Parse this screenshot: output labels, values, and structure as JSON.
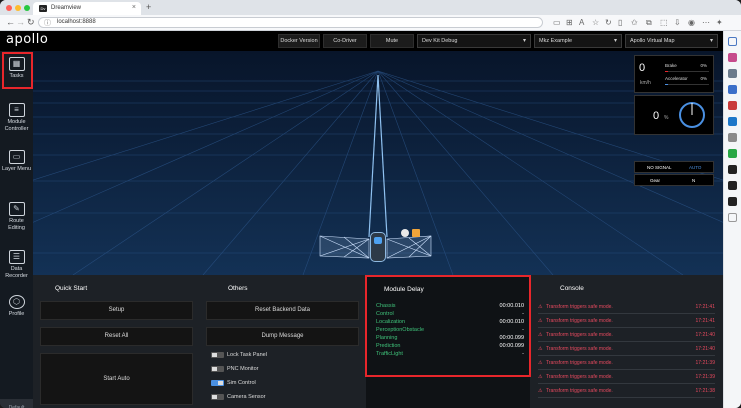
{
  "browser": {
    "tab_title": "Dreamview",
    "tab_favicon": "Dv",
    "url": "localhost:8888",
    "new_tab_glyph": "+",
    "close_glyph": "×"
  },
  "app": {
    "logo": "apollo",
    "nav": {
      "docker_version": "Docker Version",
      "co_driver": "Co-Driver",
      "mute": "Mute",
      "mode": "Dev Kit Debug",
      "scenario": "Mkz Example",
      "map": "Apollo Virtual Map"
    },
    "sidebar": {
      "items": [
        {
          "label": "Tasks",
          "icon": "tasks-grid-icon"
        },
        {
          "label": "Module Controller",
          "icon": "module-controller-icon"
        },
        {
          "label": "Layer Menu",
          "icon": "layer-menu-icon"
        },
        {
          "label": "Route Editing",
          "icon": "route-editing-icon"
        },
        {
          "label": "Data Recorder",
          "icon": "data-recorder-icon"
        },
        {
          "label": "Profile",
          "icon": "profile-icon"
        }
      ],
      "default_routing": "Default Routing"
    },
    "dashboard": {
      "speed": "0",
      "speed_unit": "km/h",
      "brake_label": "Brake",
      "brake_value": "0%",
      "accelerator_label": "Accelerator",
      "accelerator_value": "0%",
      "steering_angle": "0",
      "steering_unit": "%",
      "signal_label": "NO SIGNAL",
      "driving_mode": "AUTO",
      "gear_label": "Gear",
      "gear_value": "N"
    },
    "quick_start": {
      "title": "Quick Start",
      "setup": "Setup",
      "reset_all": "Reset All",
      "start_auto": "Start Auto"
    },
    "others": {
      "title": "Others",
      "reset_backend": "Reset Backend Data",
      "dump_message": "Dump Message",
      "toggles": [
        {
          "label": "Lock Task Panel",
          "on": false
        },
        {
          "label": "PNC Monitor",
          "on": false
        },
        {
          "label": "Sim Control",
          "on": true
        },
        {
          "label": "Camera Sensor",
          "on": false
        }
      ]
    },
    "module_delay": {
      "title": "Module Delay",
      "rows": [
        {
          "name": "Chassis",
          "value": "00:00.010"
        },
        {
          "name": "Control",
          "value": "-"
        },
        {
          "name": "Localization",
          "value": "00:00.010"
        },
        {
          "name": "PerceptionObstacle",
          "value": "-"
        },
        {
          "name": "Planning",
          "value": "00:00.099"
        },
        {
          "name": "Prediction",
          "value": "00:00.099"
        },
        {
          "name": "TrafficLight",
          "value": "-"
        }
      ]
    },
    "console": {
      "title": "Console",
      "entries": [
        {
          "message": "Transform triggers safe mode.",
          "time": "17:21:41"
        },
        {
          "message": "Transform triggers safe mode.",
          "time": "17:21:41"
        },
        {
          "message": "Transform triggers safe mode.",
          "time": "17:21:40"
        },
        {
          "message": "Transform triggers safe mode.",
          "time": "17:21:40"
        },
        {
          "message": "Transform triggers safe mode.",
          "time": "17:21:39"
        },
        {
          "message": "Transform triggers safe mode.",
          "time": "17:21:39"
        },
        {
          "message": "Transform triggers safe mode.",
          "time": "17:21:38"
        }
      ]
    }
  },
  "colors": {
    "accent_red": "#e8262b",
    "delay_green": "#3fc27a",
    "warning_red": "#e84a5f",
    "toggle_on": "#4a90e2"
  }
}
